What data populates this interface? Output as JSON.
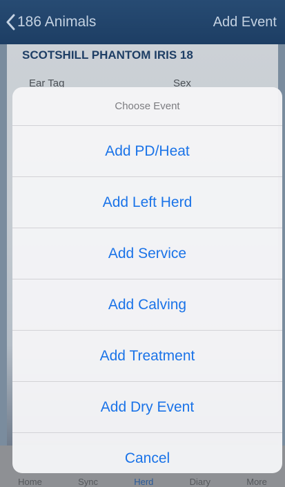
{
  "navbar": {
    "back_label": "186 Animals",
    "action_label": "Add Event"
  },
  "animal": {
    "name": "SCOTSHILL PHANTOM IRIS 18",
    "ear_tag_label": "Ear Tag",
    "sex_label": "Sex"
  },
  "tabs": [
    {
      "label": "Home"
    },
    {
      "label": "Sync"
    },
    {
      "label": "Herd"
    },
    {
      "label": "Diary"
    },
    {
      "label": "More"
    }
  ],
  "action_sheet": {
    "title": "Choose Event",
    "items": [
      {
        "label": "Add PD/Heat"
      },
      {
        "label": "Add Left Herd"
      },
      {
        "label": "Add Service"
      },
      {
        "label": "Add Calving"
      },
      {
        "label": "Add Treatment"
      },
      {
        "label": "Add Dry Event"
      },
      {
        "label": "Cancel"
      }
    ]
  },
  "colors": {
    "navbar": "#1d3e64",
    "action_text": "#1a73e8",
    "animal_name": "#1e3e65"
  }
}
